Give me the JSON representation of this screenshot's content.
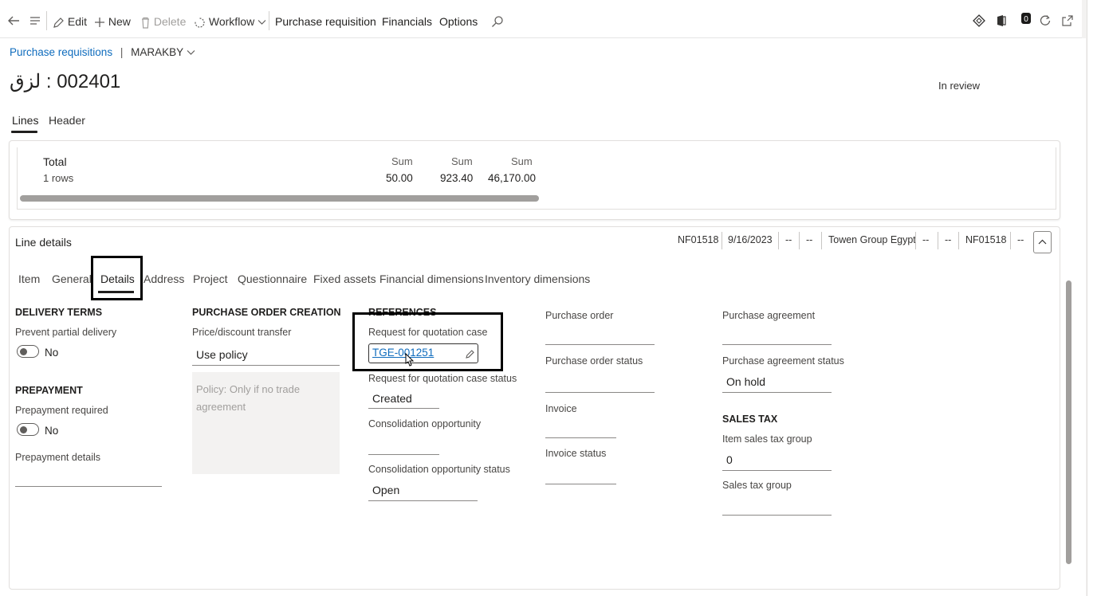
{
  "toolbar": {
    "edit": "Edit",
    "new": "New",
    "delete": "Delete",
    "workflow": "Workflow",
    "purchase_requisition": "Purchase requisition",
    "financials": "Financials",
    "options": "Options"
  },
  "breadcrumb": {
    "parent": "Purchase requisitions",
    "separator": "|",
    "company": "MARAKBY"
  },
  "record": {
    "title": "002401 : لزق",
    "status": "In review"
  },
  "view_tabs": {
    "lines": "Lines",
    "header": "Header"
  },
  "totals": {
    "label": "Total",
    "rows": "1 rows",
    "sum_label": "Sum",
    "sum1": "50.00",
    "sum2": "923.40",
    "sum3": "46,170.00"
  },
  "line_details": {
    "title": "Line details",
    "facts": [
      "NF01518",
      "9/16/2023",
      "--",
      "--",
      "Towen Group Egypt",
      "--",
      "--",
      "NF01518",
      "--"
    ]
  },
  "detail_tabs": [
    "Item",
    "General",
    "Details",
    "Address",
    "Project",
    "Questionnaire",
    "Fixed assets",
    "Financial dimensions",
    "Inventory dimensions"
  ],
  "delivery": {
    "heading": "DELIVERY TERMS",
    "prevent_label": "Prevent partial delivery",
    "prevent_value": "No"
  },
  "prepayment": {
    "heading": "PREPAYMENT",
    "required_label": "Prepayment required",
    "required_value": "No",
    "details_label": "Prepayment details"
  },
  "po_creation": {
    "heading": "PURCHASE ORDER CREATION",
    "price_label": "Price/discount transfer",
    "price_value": "Use policy",
    "policy_note": "Policy: Only if no trade agreement"
  },
  "references": {
    "heading": "REFERENCES",
    "rfq_case_label": "Request for quotation case",
    "rfq_case_value": "TGE-001251",
    "rfq_status_label": "Request for quotation case status",
    "rfq_status_value": "Created",
    "consolidation_label": "Consolidation opportunity",
    "consolidation_status_label": "Consolidation opportunity status",
    "consolidation_status_value": "Open"
  },
  "purchase_order": {
    "po_label": "Purchase order",
    "po_status_label": "Purchase order status",
    "invoice_label": "Invoice",
    "invoice_status_label": "Invoice status"
  },
  "agreement": {
    "label": "Purchase agreement",
    "status_label": "Purchase agreement status",
    "status_value": "On hold"
  },
  "sales_tax": {
    "heading": "SALES TAX",
    "item_group_label": "Item sales tax group",
    "item_group_value": "0",
    "group_label": "Sales tax group"
  }
}
